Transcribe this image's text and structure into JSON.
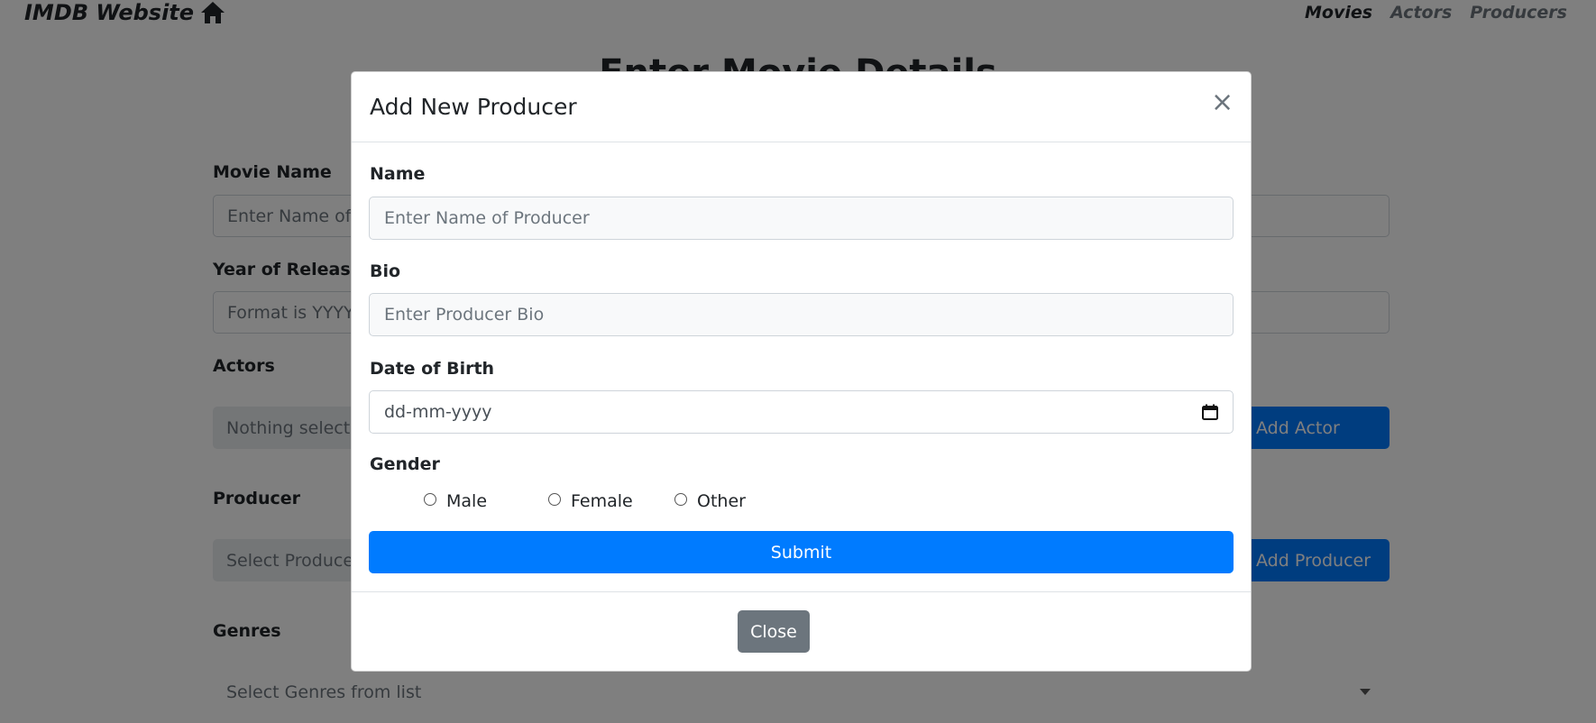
{
  "navbar": {
    "brand": "IMDB Website",
    "brand_icon": "home-icon",
    "links": [
      {
        "label": "Movies",
        "active": true
      },
      {
        "label": "Actors",
        "active": false
      },
      {
        "label": "Producers",
        "active": false
      }
    ]
  },
  "form": {
    "heading": "Enter Movie Details",
    "movie_name_label": "Movie Name",
    "movie_name_placeholder": "Enter Name of Movie",
    "year_label": "Year of Release",
    "year_placeholder": "Format is YYYY",
    "actors_label": "Actors",
    "actors_placeholder": "Nothing selected",
    "add_actor_button": "Add Actor",
    "producer_label": "Producer",
    "producer_placeholder": "Select Producer",
    "add_producer_button": "Add Producer",
    "genres_label": "Genres",
    "genres_placeholder": "Select Genres from list"
  },
  "modal": {
    "title": "Add New Producer",
    "close_symbol": "×",
    "name_label": "Name",
    "name_placeholder": "Enter Name of Producer",
    "bio_label": "Bio",
    "bio_placeholder": "Enter Producer Bio",
    "dob_label": "Date of Birth",
    "dob_placeholder": "dd-mm-yyyy",
    "gender_label": "Gender",
    "gender_options": [
      "Male",
      "Female",
      "Other"
    ],
    "submit_label": "Submit",
    "close_label": "Close"
  },
  "colors": {
    "primary": "#007bff",
    "secondary": "#6c757d",
    "backdrop": "rgba(0,0,0,0.5)"
  }
}
